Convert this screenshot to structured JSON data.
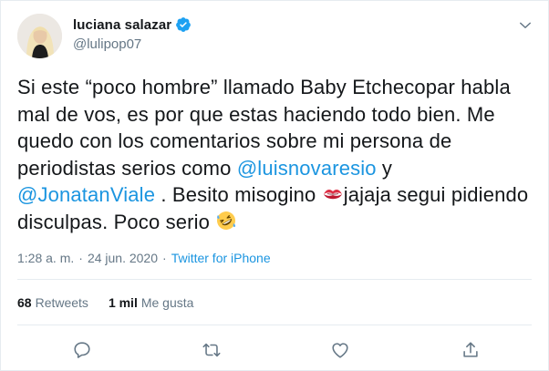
{
  "author": {
    "display_name": "luciana salazar",
    "handle": "@lulipop07",
    "verified": true
  },
  "tweet": {
    "text_part1": "Si este “poco hombre” llamado Baby Etchecopar habla mal de vos, es por que estas haciendo todo bien. Me quedo con los comentarios sobre mi persona de periodistas serios como ",
    "mention1": "@luisnovaresio",
    "text_part2": " y ",
    "mention2": "@JonatanViale",
    "text_part3": " . Besito misogino ",
    "emoji1": "kiss-mark-emoji",
    "text_part4": "jajaja segui pidiendo disculpas. Poco serio ",
    "emoji2": "rolling-on-the-floor-laughing-emoji"
  },
  "meta": {
    "time": "1:28 a. m.",
    "separator1": "·",
    "date": "24 jun. 2020",
    "separator2": "·",
    "source": "Twitter for iPhone"
  },
  "stats": {
    "retweets_count": "68",
    "retweets_label": "Retweets",
    "likes_count": "1 mil",
    "likes_label": "Me gusta"
  },
  "icons": {
    "caret": "chevron-down-icon",
    "reply": "reply-icon",
    "retweet": "retweet-icon",
    "like": "like-icon",
    "share": "share-icon"
  },
  "colors": {
    "link": "#1b95e0",
    "secondary_text": "#657786",
    "primary_text": "#14171a",
    "verified": "#1da1f2",
    "divider": "#e6ecf0"
  }
}
